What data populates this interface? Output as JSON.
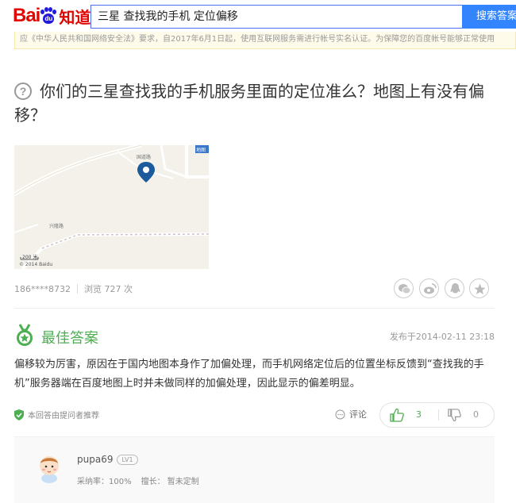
{
  "header": {
    "logo_bai": "Bai",
    "logo_du": "du",
    "logo_zhidao": "知道",
    "search_value": "三星 查找我的手机 定位偏移",
    "search_button": "搜索答案"
  },
  "notice": "应《中华人民共和国网络安全法》要求，自2017年6月1日起，使用互联网服务需进行帐号实名认证。为保障您的百度帐号能够正常使用",
  "question": {
    "icon": "?",
    "title": "你们的三星查找我的手机服务里面的定位准么？地图上有没有偏移？",
    "map": {
      "label_top": "国道路",
      "label_left": "兴隆路",
      "badge": "地图",
      "scale": "200 米",
      "copyright": "© 2014 Baidu"
    },
    "asker": "186****8732",
    "views": "浏览 727 次"
  },
  "share_icons": [
    "wechat-icon",
    "weibo-icon",
    "qq-icon",
    "star-icon"
  ],
  "best_answer": {
    "title": "最佳答案",
    "time": "发布于2014-02-11 23:18",
    "text": "偏移较为厉害，原因在于国内地图本身作了加偏处理，而手机网络定位后的位置坐标反馈到“查找我的手机”服务器端在百度地图上时并未做同样的加偏处理，因此显示的偏差明显。",
    "recommend": "本回答由提问者推荐",
    "comment_label": "评论",
    "upvotes": "3",
    "downvotes": "0"
  },
  "answerer": {
    "name": "pupa69",
    "level": "LV1",
    "adopt_rate": "采纳率：100%",
    "specialty": "擅长： 暂未定制"
  },
  "colors": {
    "accent": "#3385ff",
    "brand_red": "#e10601",
    "brand_blue": "#2319dc",
    "best_green": "#4dae52"
  }
}
